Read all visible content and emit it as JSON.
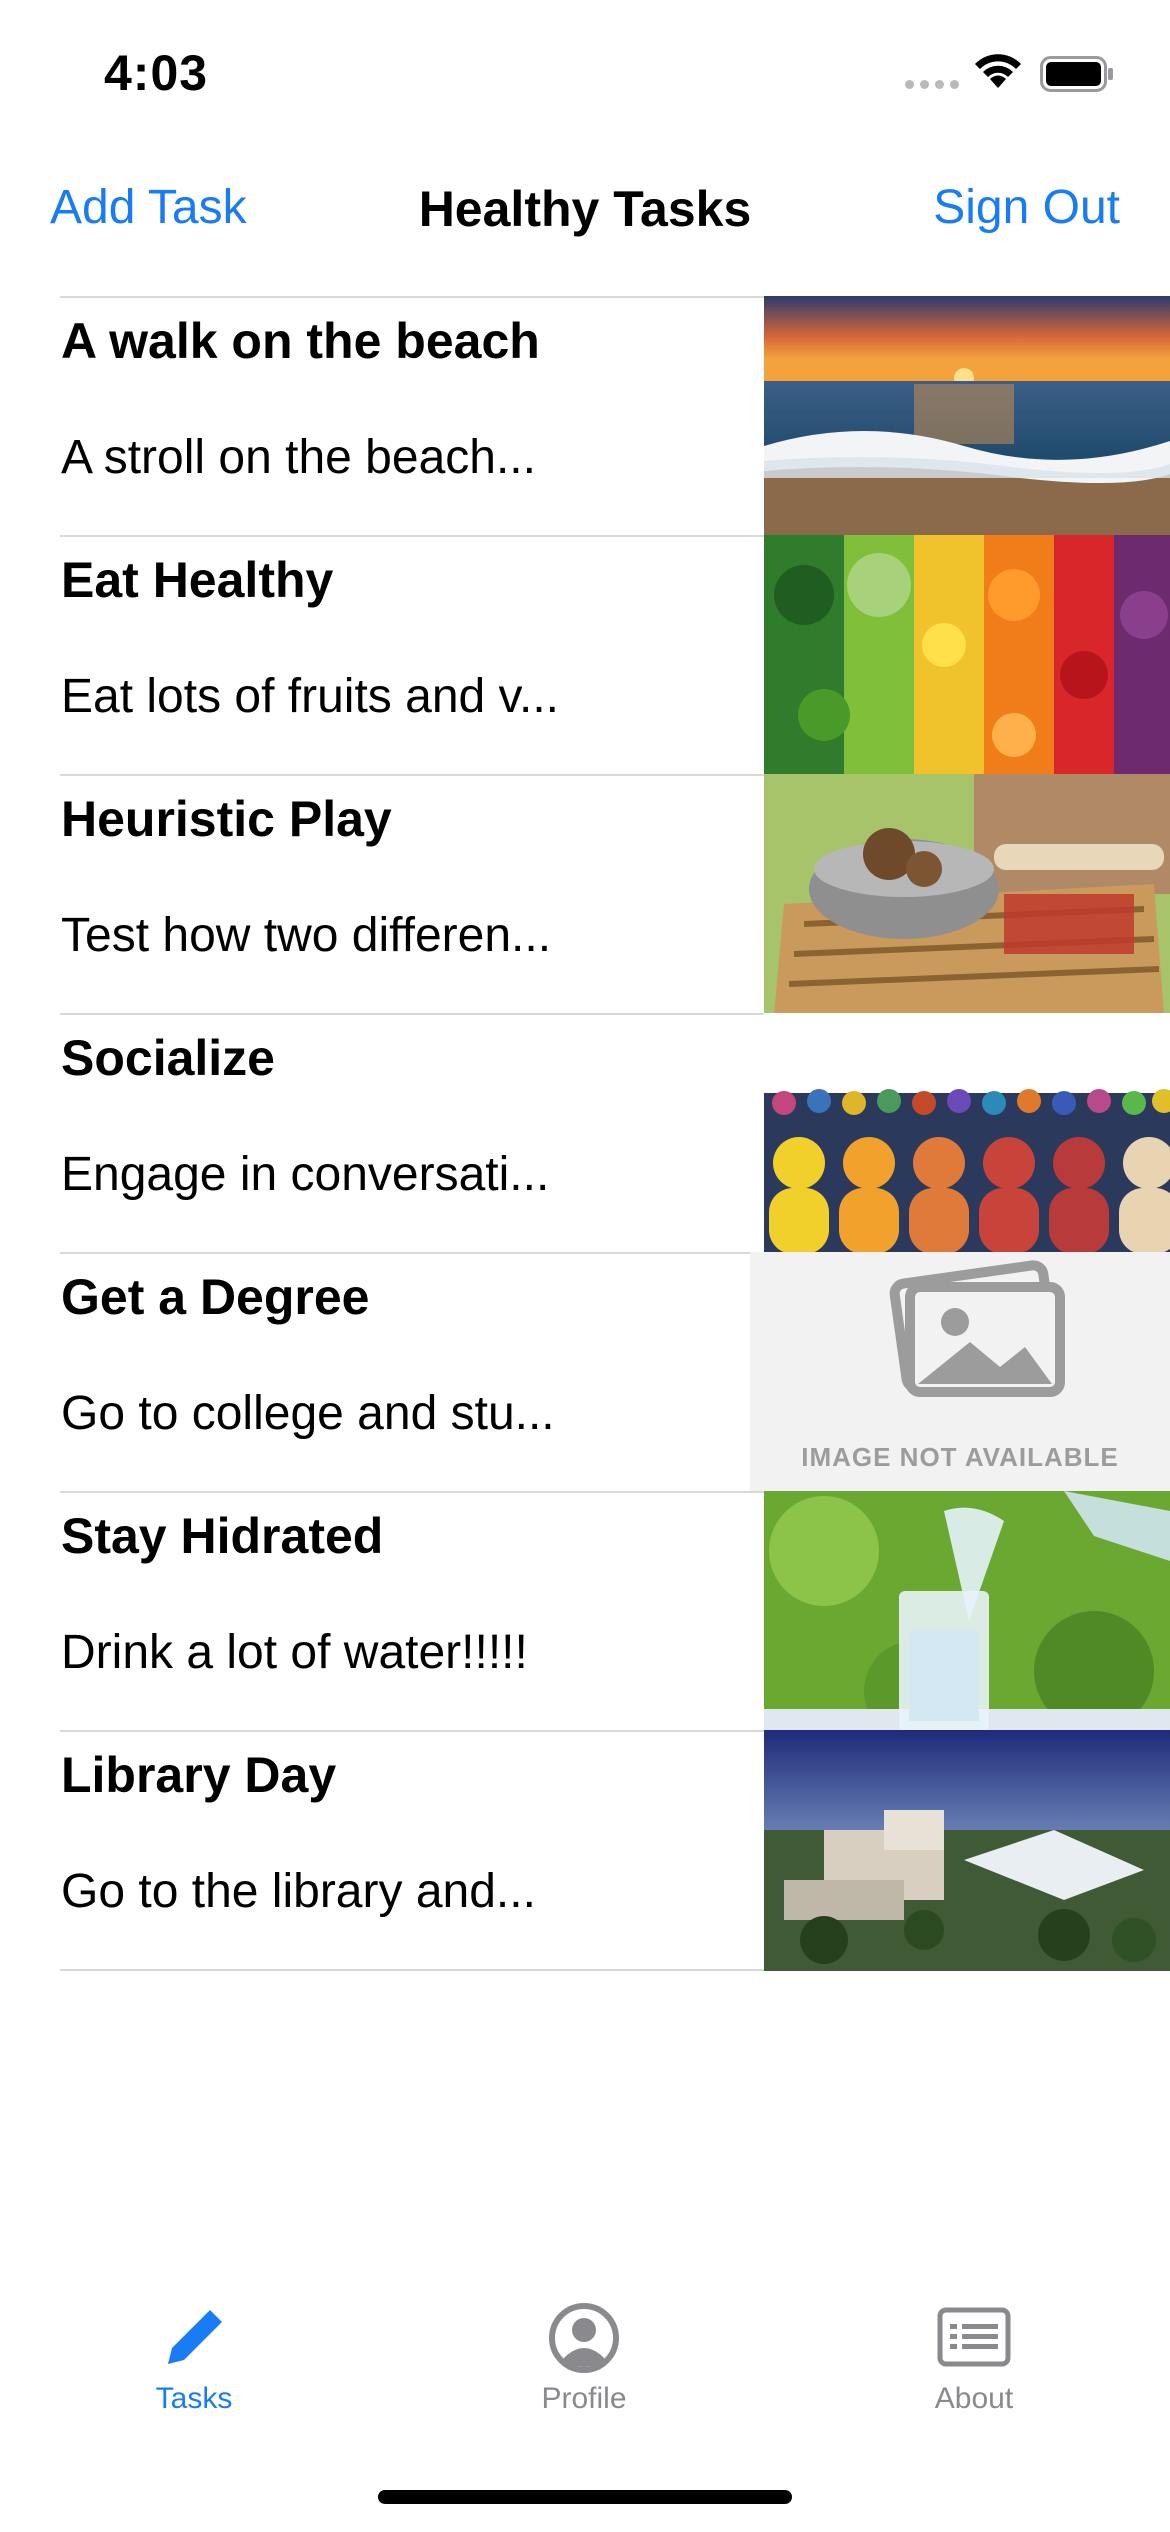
{
  "status_bar": {
    "time": "4:03"
  },
  "nav": {
    "left_label": "Add Task",
    "title": "Healthy Tasks",
    "right_label": "Sign Out",
    "accent_color": "#1a7cf5"
  },
  "tasks": [
    {
      "title": "A walk on the beach",
      "description": "A stroll on the beach...",
      "image": "beach-sunset"
    },
    {
      "title": "Eat Healthy",
      "description": "Eat lots of fruits and v...",
      "image": "fruits-vegetables"
    },
    {
      "title": "Heuristic Play",
      "description": "Test how two differen...",
      "image": "basket-objects"
    },
    {
      "title": "Socialize",
      "description": "Engage in conversati...",
      "image": "crowd-people"
    },
    {
      "title": "Get a Degree",
      "description": "Go to college and stu...",
      "image": "image-not-available",
      "placeholder_text": "IMAGE NOT AVAILABLE"
    },
    {
      "title": "Stay Hidrated",
      "description": "Drink a lot of water!!!!!",
      "image": "water-glass"
    },
    {
      "title": "Library Day",
      "description": "Go to the library and...",
      "image": "campus-library"
    }
  ],
  "tab_bar": {
    "tabs": [
      {
        "label": "Tasks",
        "icon": "pencil-icon",
        "active": true
      },
      {
        "label": "Profile",
        "icon": "person-circle-icon",
        "active": false
      },
      {
        "label": "About",
        "icon": "list-card-icon",
        "active": false
      }
    ]
  }
}
